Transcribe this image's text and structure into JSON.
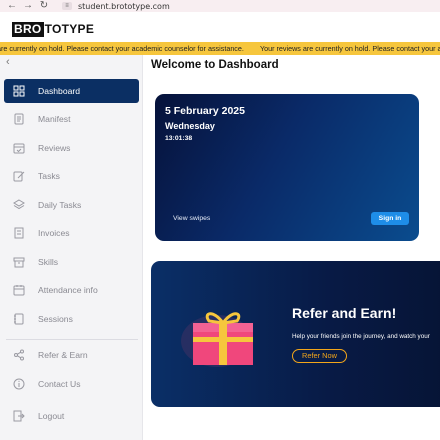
{
  "browser": {
    "url": "student.brototype.com"
  },
  "logo": {
    "part1": "BRO",
    "part2": "TOTYPE"
  },
  "notice": {
    "text_left": "are currently on hold. Please contact your academic counselor for assistance.",
    "text_right": "Your reviews are currently on hold. Please contact your a"
  },
  "sidebar": {
    "items": [
      {
        "label": "Dashboard",
        "icon": "dashboard-icon"
      },
      {
        "label": "Manifest",
        "icon": "document-icon"
      },
      {
        "label": "Reviews",
        "icon": "calendar-check-icon"
      },
      {
        "label": "Tasks",
        "icon": "edit-icon"
      },
      {
        "label": "Daily Tasks",
        "icon": "layers-icon"
      },
      {
        "label": "Invoices",
        "icon": "invoice-icon"
      },
      {
        "label": "Skills",
        "icon": "archive-icon"
      },
      {
        "label": "Attendance info",
        "icon": "calendar-icon"
      },
      {
        "label": "Sessions",
        "icon": "notebook-icon"
      },
      {
        "label": "Refer & Earn",
        "icon": "share-icon"
      },
      {
        "label": "Contact Us",
        "icon": "info-icon"
      },
      {
        "label": "Logout",
        "icon": "logout-icon"
      }
    ]
  },
  "main": {
    "welcome": "Welcome to Dashboard",
    "date_card": {
      "date": "5 February 2025",
      "day": "Wednesday",
      "time": "13:01:38",
      "view_swipes": "View swipes",
      "sign_in": "Sign in"
    },
    "refer_card": {
      "title": "Refer and Earn!",
      "subtitle": "Help your friends join the journey, and watch your",
      "button": "Refer Now"
    }
  },
  "colors": {
    "sidebar_active": "#0b2f63",
    "notice_bg": "#f6c63d",
    "signin_button": "#1e8de8",
    "refer_accent": "#f3a61a"
  }
}
